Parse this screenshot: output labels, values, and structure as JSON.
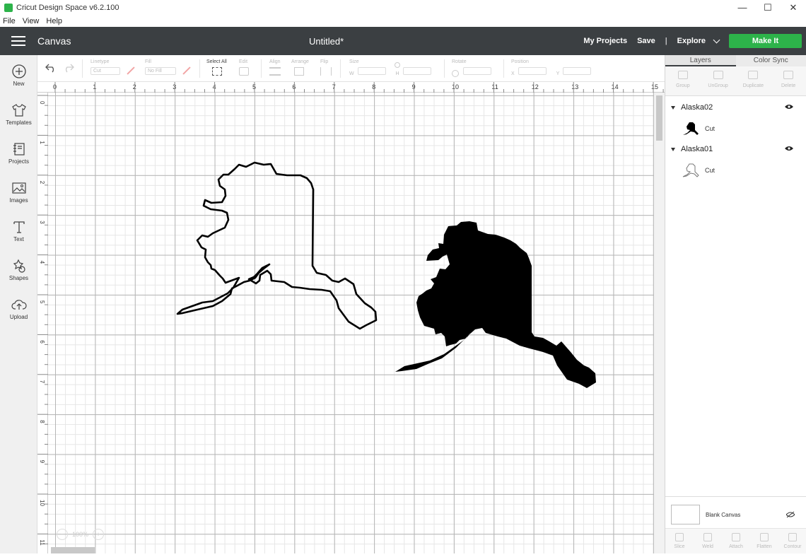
{
  "window": {
    "title": "Cricut Design Space  v6.2.100",
    "minimize": "—",
    "maximize": "☐",
    "close": "✕"
  },
  "menu": [
    "File",
    "View",
    "Help"
  ],
  "header": {
    "section": "Canvas",
    "document_title": "Untitled*",
    "my_projects": "My Projects",
    "save": "Save",
    "separator": "|",
    "explore": "Explore",
    "make_it": "Make It"
  },
  "sidebar": [
    {
      "label": "New",
      "icon": "plus-circle-icon"
    },
    {
      "label": "Templates",
      "icon": "shirt-icon"
    },
    {
      "label": "Projects",
      "icon": "projects-icon"
    },
    {
      "label": "Images",
      "icon": "image-icon"
    },
    {
      "label": "Text",
      "icon": "text-icon"
    },
    {
      "label": "Shapes",
      "icon": "shapes-icon"
    },
    {
      "label": "Upload",
      "icon": "cloud-upload-icon"
    }
  ],
  "toolbar": {
    "linetype_label": "Linetype",
    "linetype_value": "Cut",
    "fill_label": "Fill",
    "fill_value": "No Fill",
    "select_all": "Select All",
    "edit": "Edit",
    "align": "Align",
    "arrange": "Arrange",
    "flip": "Flip",
    "size": "Size",
    "w": "W",
    "h": "H",
    "rotate": "Rotate",
    "position": "Position",
    "x": "X",
    "y": "Y"
  },
  "ruler": {
    "top": [
      "0",
      "1",
      "2",
      "3",
      "4",
      "5",
      "6",
      "7",
      "8",
      "9",
      "10",
      "11",
      "12",
      "13",
      "14",
      "15"
    ],
    "left": [
      "0",
      "1",
      "2",
      "3",
      "4",
      "5",
      "6",
      "7",
      "8",
      "9",
      "10",
      "11"
    ]
  },
  "zoom": {
    "minus": "−",
    "value": "100%",
    "plus": "+"
  },
  "panel": {
    "tabs": [
      "Layers",
      "Color Sync"
    ],
    "tools": [
      "Group",
      "UnGroup",
      "Duplicate",
      "Delete"
    ],
    "layers": [
      {
        "name": "Alaska02",
        "operation": "Cut",
        "style": "filled"
      },
      {
        "name": "Alaska01",
        "operation": "Cut",
        "style": "outline"
      }
    ],
    "blank_canvas": "Blank Canvas",
    "bottom_tools": [
      "Slice",
      "Weld",
      "Attach",
      "Flatten",
      "Contour"
    ]
  },
  "colors": {
    "header": "#3b3f42",
    "make_it": "#2db34a",
    "shape": "#000000"
  }
}
